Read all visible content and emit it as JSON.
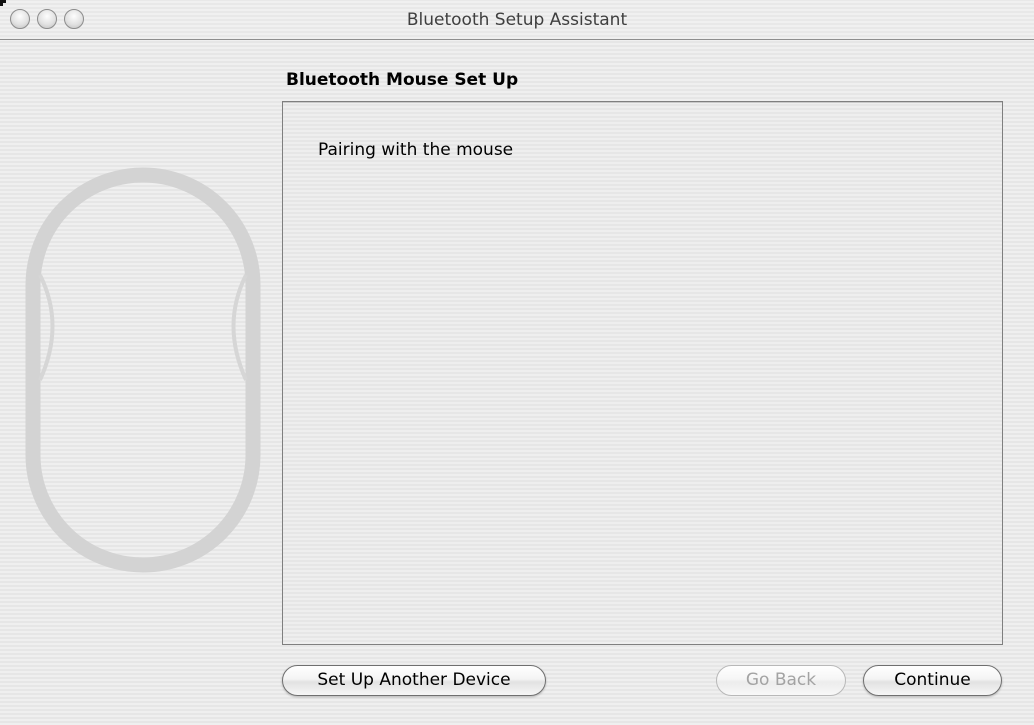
{
  "window": {
    "title": "Bluetooth Setup Assistant"
  },
  "titlebar": {
    "controls": [
      "close",
      "minimize",
      "zoom"
    ]
  },
  "graphic": {
    "icon": "mouse-outline-icon"
  },
  "main": {
    "section_title": "Bluetooth Mouse Set Up",
    "status_text": "Pairing with the mouse"
  },
  "buttons": {
    "setup_another": "Set Up Another Device",
    "go_back": "Go Back",
    "continue": "Continue"
  }
}
